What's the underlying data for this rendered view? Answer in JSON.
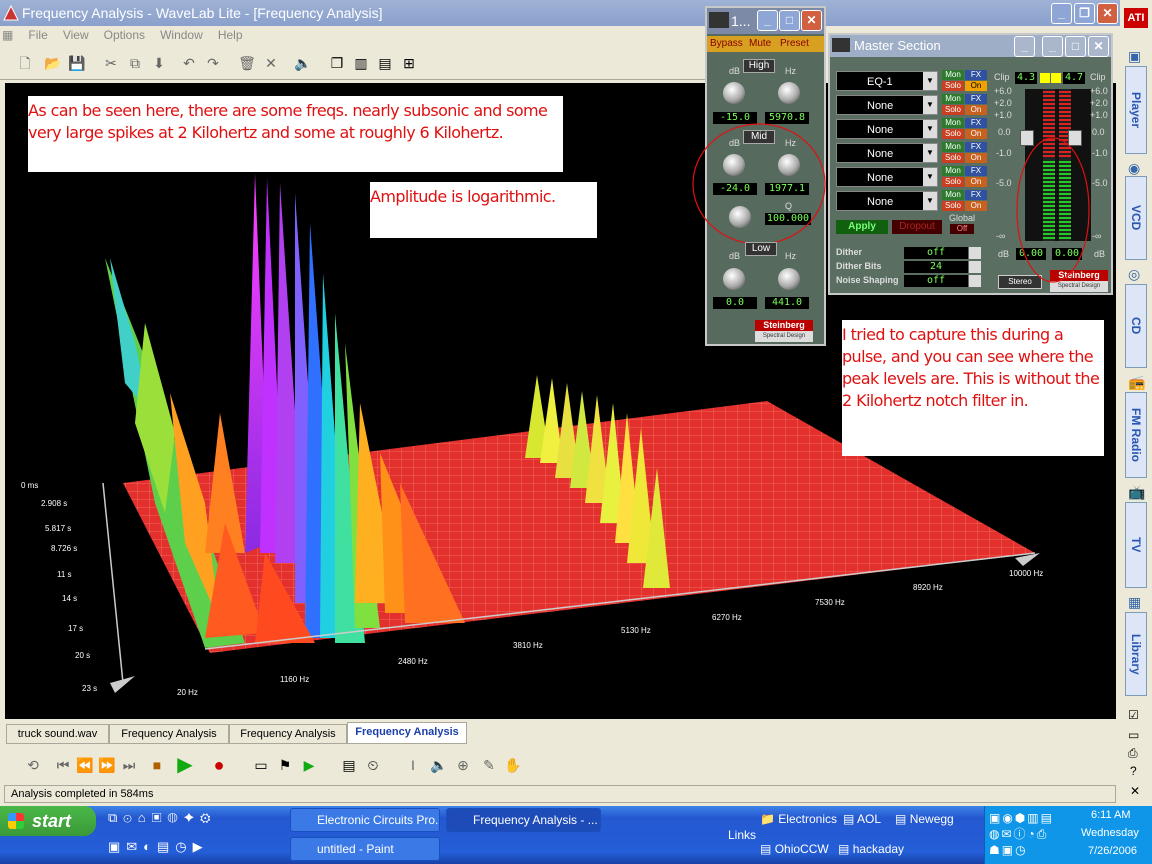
{
  "window": {
    "title": "Frequency Analysis - WaveLab Lite - [Frequency Analysis]"
  },
  "menu": [
    "File",
    "View",
    "Options",
    "Window",
    "Help"
  ],
  "notes": {
    "top": "As can be seen here, there are some freqs. nearly subsonic and some very large spikes at 2 Kilohertz and some at roughly 6 Kilohertz.",
    "amp": "Amplitude is logarithmic.",
    "right": "I tried to capture this during a pulse, and you can see where the peak levels are. This is without the 2 Kilohertz notch filter in."
  },
  "axes": {
    "freq": [
      "20 Hz",
      "1160 Hz",
      "2480 Hz",
      "3810 Hz",
      "5130 Hz",
      "6270 Hz",
      "7530 Hz",
      "8920 Hz",
      "10000 Hz"
    ],
    "time": [
      "0 ms",
      "2.908 s",
      "5.817 s",
      "8.726 s",
      "11 s",
      "14 s",
      "17 s",
      "20 s",
      "23 s"
    ]
  },
  "eq": {
    "title": "1...",
    "buttons": [
      "Bypass",
      "Mute",
      "Preset"
    ],
    "high": {
      "label": "High",
      "unit_db": "dB",
      "unit_hz": "Hz",
      "db": "-15.0",
      "hz": "5970.8"
    },
    "mid": {
      "label": "Mid",
      "unit_db": "dB",
      "unit_hz": "Hz",
      "db": "-24.0",
      "hz": "1977.1",
      "q_label": "Q",
      "q": "100.000"
    },
    "low": {
      "label": "Low",
      "unit_db": "dB",
      "unit_hz": "Hz",
      "db": "0.0",
      "hz": "441.0"
    },
    "brand": "Steinberg",
    "brand_sub": "Spectral Design"
  },
  "master": {
    "title": "Master Section",
    "slots": [
      "EQ-1",
      "None",
      "None",
      "None",
      "None",
      "None"
    ],
    "mon": "Mon",
    "fx": "FX",
    "solo": "Solo",
    "on": "On",
    "apply": "Apply",
    "dropout": "Dropout",
    "global": "Global",
    "global_val": "Off",
    "dither": {
      "label": "Dither",
      "value": "off"
    },
    "dither_bits": {
      "label": "Dither Bits",
      "value": "24"
    },
    "noise_shaping": {
      "label": "Noise Shaping",
      "value": "off"
    },
    "clip": "Clip",
    "clip_l": "4.3",
    "clip_r": "4.7",
    "scale": [
      "+6.0",
      "+2.0",
      "+1.0",
      "0.0",
      "-1.0",
      "-5.0",
      "-∞"
    ],
    "out_l": "0.00",
    "out_r": "0.00",
    "db": "dB",
    "stereo": "Stereo",
    "brand": "Steinberg",
    "brand_sub": "Spectral Design"
  },
  "tabs": [
    "truck sound.wav",
    "Frequency Analysis",
    "Frequency Analysis",
    "Frequency Analysis"
  ],
  "status": "Analysis completed in 584ms",
  "sidebar": [
    "Player",
    "VCD",
    "CD",
    "FM Radio",
    "TV",
    "Library"
  ],
  "sidebar_brand": "ATI",
  "taskbar": {
    "start": "start",
    "tasks": [
      "Electronic Circuits Pro...",
      "Frequency Analysis - ...",
      "untitled - Paint"
    ],
    "links_label": "Links",
    "links": [
      "Electronics",
      "AOL",
      "Newegg",
      "OhioCCW",
      "hackaday"
    ],
    "time": "6:11 AM",
    "day": "Wednesday",
    "date": "7/26/2006"
  },
  "colors": {
    "accent_red": "#e01010",
    "lcd_green": "#7bff5a",
    "plot_floor": "#e02a2a",
    "xp_blue": "#245ed8"
  }
}
